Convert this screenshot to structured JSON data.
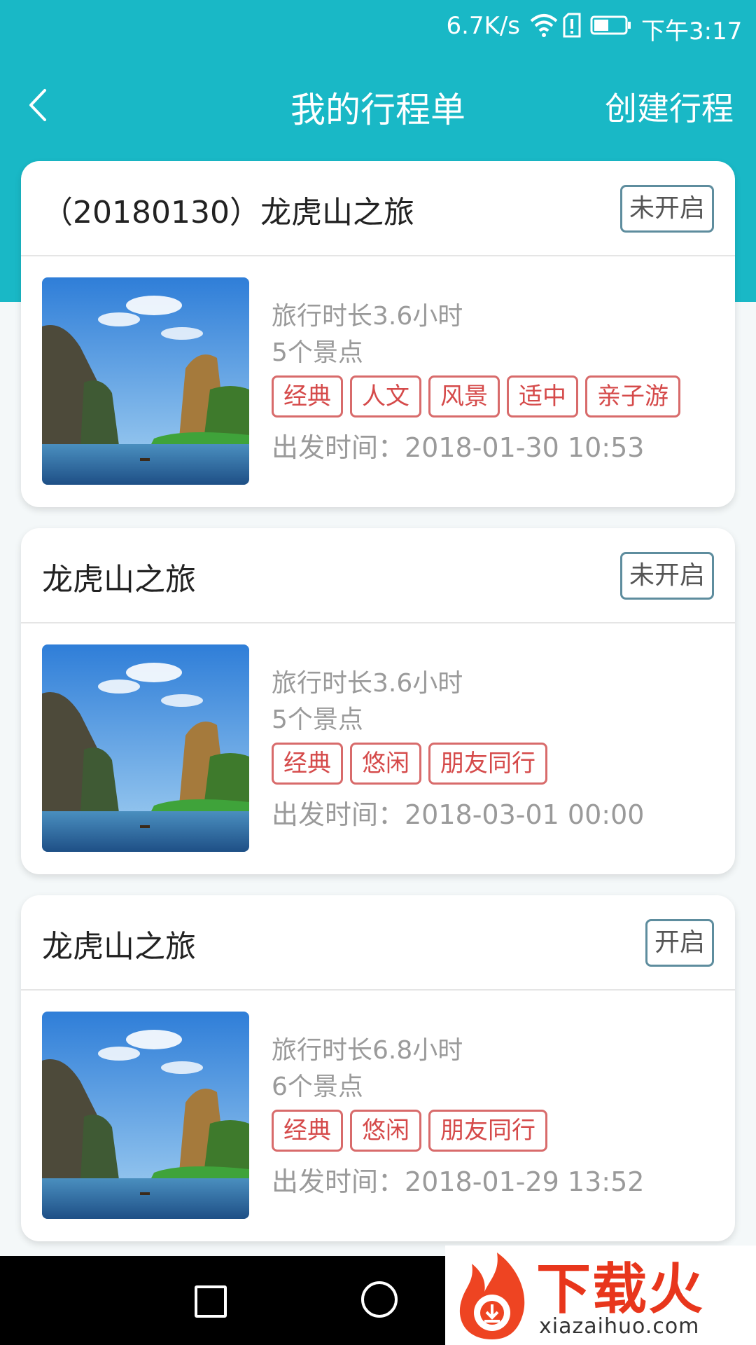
{
  "status_bar": {
    "net_speed": "6.7K/s",
    "time": "下午3:17"
  },
  "header": {
    "title": "我的行程单",
    "create_label": "创建行程"
  },
  "trips": [
    {
      "title": "（20180130）龙虎山之旅",
      "status": "未开启",
      "duration": "旅行时长3.6小时",
      "spots": "5个景点",
      "tags": [
        "经典",
        "人文",
        "风景",
        "适中",
        "亲子游"
      ],
      "depart": "出发时间：2018-01-30 10:53"
    },
    {
      "title": "龙虎山之旅",
      "status": "未开启",
      "duration": "旅行时长3.6小时",
      "spots": "5个景点",
      "tags": [
        "经典",
        "悠闲",
        "朋友同行"
      ],
      "depart": "出发时间：2018-03-01 00:00"
    },
    {
      "title": "龙虎山之旅",
      "status": "开启",
      "duration": "旅行时长6.8小时",
      "spots": "6个景点",
      "tags": [
        "经典",
        "悠闲",
        "朋友同行"
      ],
      "depart": "出发时间：2018-01-29 13:52"
    }
  ],
  "watermark": {
    "brand": "下载火",
    "url": "xiazaihuo.com"
  },
  "colors": {
    "header_bg": "#19b8c6",
    "tag_red": "#d54a4a",
    "status_border": "#5e8d9e"
  }
}
